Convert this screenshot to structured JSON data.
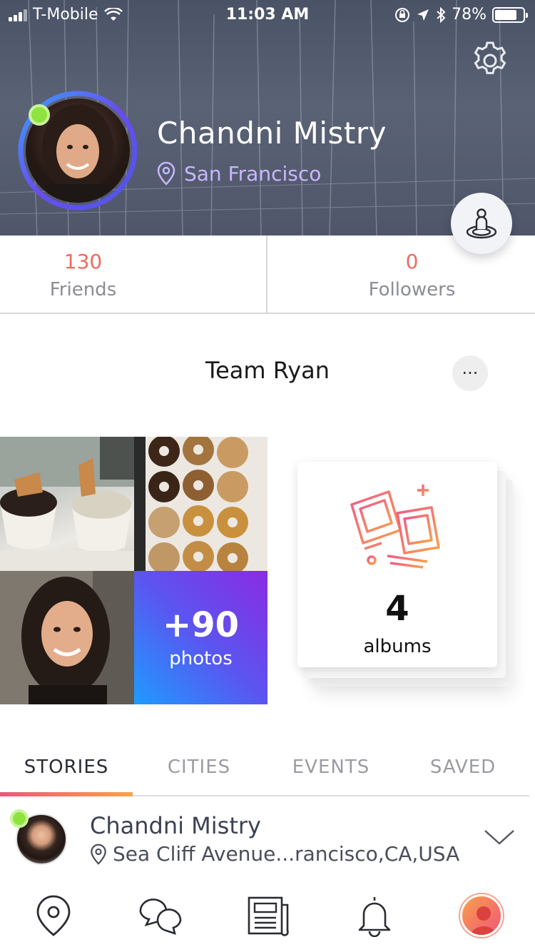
{
  "status_bar": {
    "carrier": "T-Mobile",
    "time": "11:03 AM",
    "battery": "78%"
  },
  "profile": {
    "name": "Chandni Mistry",
    "location": "San Francisco",
    "online": true
  },
  "stats": {
    "friends_value": "130",
    "friends_label": "Friends",
    "followers_value": "0",
    "followers_label": "Followers"
  },
  "team": {
    "title": "Team Ryan",
    "more_label": "···"
  },
  "photos": {
    "more_count": "+90",
    "more_label": "photos"
  },
  "albums": {
    "count": "4",
    "label": "albums"
  },
  "tabs": [
    {
      "label": "STORIES",
      "active": true
    },
    {
      "label": "CITIES",
      "active": false
    },
    {
      "label": "EVENTS",
      "active": false
    },
    {
      "label": "SAVED",
      "active": false
    }
  ],
  "story": {
    "name": "Chandni Mistry",
    "location": "Sea Cliff Avenue...rancisco,CA,USA"
  },
  "bottom_nav": [
    {
      "icon": "map-pin-icon"
    },
    {
      "icon": "chat-bubbles-icon"
    },
    {
      "icon": "newspaper-icon"
    },
    {
      "icon": "bell-icon"
    },
    {
      "icon": "profile-avatar-icon"
    }
  ],
  "colors": {
    "accent_red": "#f06a5e",
    "location_purple": "#c9b7ff",
    "online_green": "#8ee33f",
    "tab_gradient_start": "#f0567b",
    "tab_gradient_end": "#f7a34a",
    "photos_gradient_start": "#1e9bff",
    "photos_gradient_end": "#8a2be2"
  }
}
